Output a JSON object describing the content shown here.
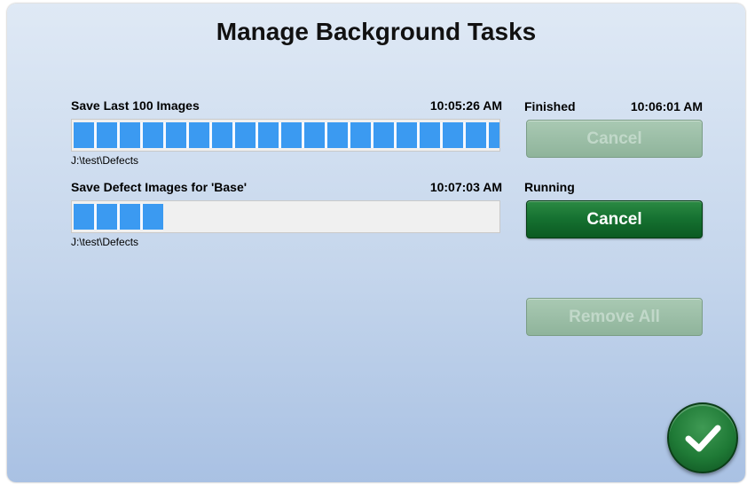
{
  "dialog": {
    "title": "Manage Background Tasks"
  },
  "tasks": [
    {
      "name": "Save Last 100 Images",
      "time": "10:05:26 AM",
      "path": "J:\\test\\Defects",
      "progress": 1.0,
      "status": "Finished",
      "finished_time": "10:06:01 AM",
      "cancel_label": "Cancel",
      "cancel_enabled": false
    },
    {
      "name": "Save Defect Images for 'Base'",
      "time": "10:07:03 AM",
      "path": "J:\\test\\Defects",
      "progress": 0.21,
      "status": "Running",
      "cancel_label": "Cancel",
      "cancel_enabled": true
    }
  ],
  "actions": {
    "remove_all_label": "Remove All",
    "remove_all_enabled": false,
    "ok_icon": "checkmark-icon"
  },
  "colors": {
    "progress": "#3b9af1",
    "button_green": "#157030",
    "background_top": "#dfe9f5",
    "background_bottom": "#a9c1e3"
  }
}
